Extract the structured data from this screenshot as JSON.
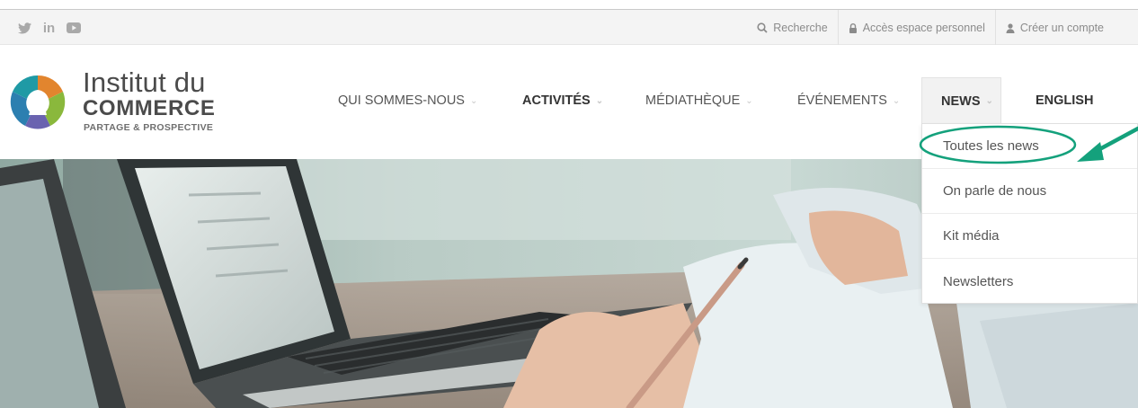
{
  "topbar": {
    "social": [
      {
        "name": "twitter",
        "icon": "twitter-icon"
      },
      {
        "name": "linkedin",
        "icon": "linkedin-icon",
        "glyph": "in"
      },
      {
        "name": "youtube",
        "icon": "youtube-icon"
      }
    ],
    "search_label": "Recherche",
    "personal_space_label": "Accès espace personnel",
    "create_account_label": "Créer un compte"
  },
  "logo": {
    "line1": "Institut du",
    "line2": "COMMERCE",
    "line3": "PARTAGE & PROSPECTIVE",
    "colors": [
      "#1f9aa5",
      "#e2852e",
      "#8ab83c",
      "#4e6bb4",
      "#8b5da8"
    ]
  },
  "nav": {
    "items": [
      {
        "label": "QUI SOMMES-NOUS",
        "has_menu": true
      },
      {
        "label": "ACTIVITÉS",
        "has_menu": true
      },
      {
        "label": "MÉDIATHÈQUE",
        "has_menu": true
      },
      {
        "label": "ÉVÉNEMENTS",
        "has_menu": true
      },
      {
        "label": "NEWS",
        "has_menu": true,
        "active": true
      },
      {
        "label": "ENGLISH",
        "has_menu": false
      }
    ]
  },
  "dropdown": {
    "items": [
      {
        "label": "Toutes les news",
        "highlighted": true
      },
      {
        "label": "On parle de nous"
      },
      {
        "label": "Kit média"
      },
      {
        "label": "Newsletters"
      }
    ]
  },
  "annotation": {
    "color": "#14a17c"
  }
}
